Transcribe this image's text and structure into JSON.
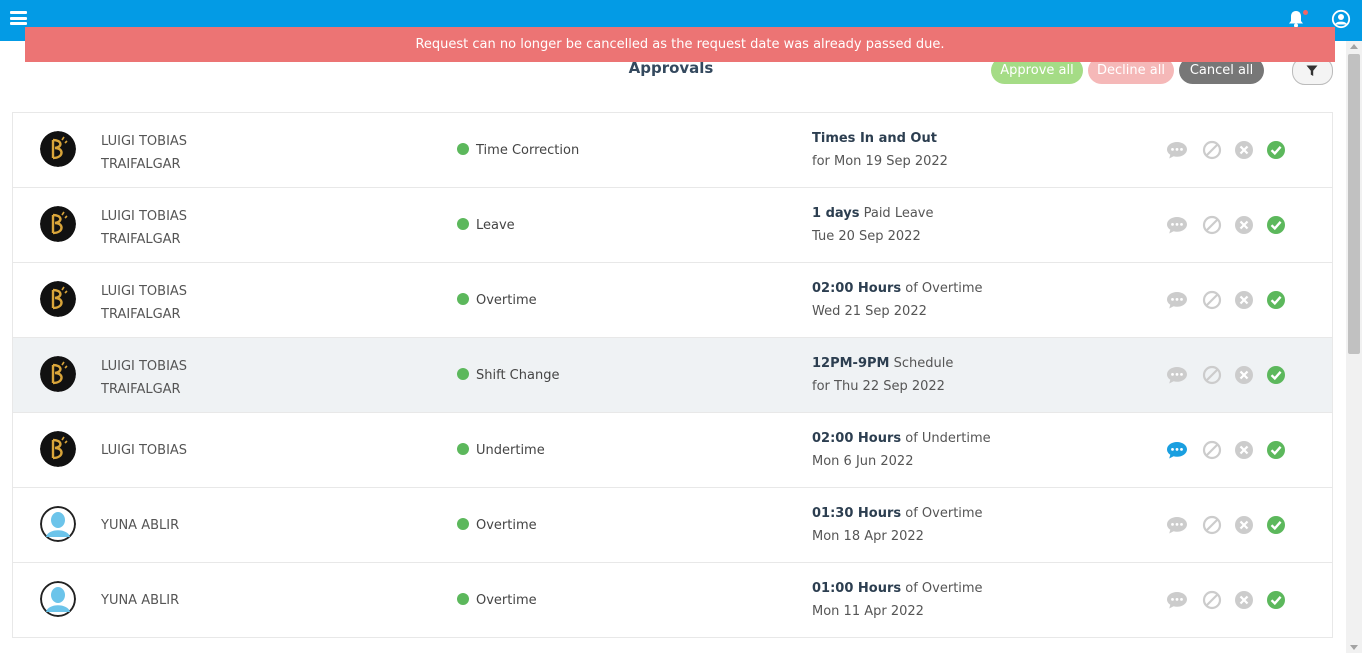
{
  "header": {
    "menu_icon": "hamburger-menu-icon",
    "notification_icon": "bell-icon",
    "account_icon": "user-circle-icon",
    "brand_color": "#039be5"
  },
  "toast": {
    "message": "Request can no longer be cancelled as the request date was already passed due.",
    "color": "#ec7474"
  },
  "page": {
    "title": "Approvals",
    "approve_all": "Approve all",
    "decline_all": "Decline all",
    "cancel_all": "Cancel all",
    "filter_icon": "filter-icon"
  },
  "approvals": [
    {
      "name_line1": "LUIGI TOBIAS",
      "name_line2": "TRAIFALGAR",
      "avatar": "b-logo-avatar",
      "type": "Time Correction",
      "detail_bold": "Times In and Out",
      "detail_rest": "",
      "detail_sub": "for Mon 19 Sep 2022",
      "has_comment": false
    },
    {
      "name_line1": "LUIGI TOBIAS",
      "name_line2": "TRAIFALGAR",
      "avatar": "b-logo-avatar",
      "type": "Leave",
      "detail_bold": "1 days",
      "detail_rest": " Paid Leave",
      "detail_sub": "Tue 20 Sep 2022",
      "has_comment": false
    },
    {
      "name_line1": "LUIGI TOBIAS",
      "name_line2": "TRAIFALGAR",
      "avatar": "b-logo-avatar",
      "type": "Overtime",
      "detail_bold": "02:00 Hours",
      "detail_rest": " of Overtime",
      "detail_sub": "Wed 21 Sep 2022",
      "has_comment": false
    },
    {
      "name_line1": "LUIGI TOBIAS",
      "name_line2": "TRAIFALGAR",
      "avatar": "b-logo-avatar",
      "type": "Shift Change",
      "detail_bold": "12PM-9PM",
      "detail_rest": " Schedule",
      "detail_sub": "for Thu 22 Sep 2022",
      "has_comment": false
    },
    {
      "name_line1": "LUIGI TOBIAS",
      "name_line2": "",
      "avatar": "b-logo-avatar",
      "type": "Undertime",
      "detail_bold": "02:00 Hours",
      "detail_rest": " of Undertime",
      "detail_sub": "Mon 6 Jun 2022",
      "has_comment": true
    },
    {
      "name_line1": "YUNA ABLIR",
      "name_line2": "",
      "avatar": "person-silhouette-avatar",
      "type": "Overtime",
      "detail_bold": "01:30 Hours",
      "detail_rest": " of Overtime",
      "detail_sub": "Mon 18 Apr 2022",
      "has_comment": false
    },
    {
      "name_line1": "YUNA ABLIR",
      "name_line2": "",
      "avatar": "person-silhouette-avatar",
      "type": "Overtime",
      "detail_bold": "01:00 Hours",
      "detail_rest": " of Overtime",
      "detail_sub": "Mon 11 Apr 2022",
      "has_comment": false
    }
  ],
  "colors": {
    "status_dot": "#5cb85c",
    "approve_icon": "#5cb85c",
    "comment_active": "#1a9fe0",
    "icon_inactive": "#cccccc"
  }
}
